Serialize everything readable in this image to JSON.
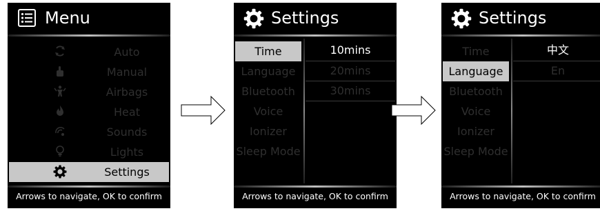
{
  "footer_text": "Arrows to navigate, OK to confirm",
  "screen1": {
    "title": "Menu",
    "items": [
      {
        "label": "Auto",
        "icon": "cycle-icon"
      },
      {
        "label": "Manual",
        "icon": "hand-icon"
      },
      {
        "label": "Airbags",
        "icon": "airbag-person-icon"
      },
      {
        "label": "Heat",
        "icon": "flame-icon"
      },
      {
        "label": "Sounds",
        "icon": "sound-icon"
      },
      {
        "label": "Lights",
        "icon": "lightbulb-icon"
      },
      {
        "label": "Settings",
        "icon": "gear-icon",
        "selected": true
      }
    ]
  },
  "screen2": {
    "title": "Settings",
    "categories": [
      "Time",
      "Language",
      "Bluetooth",
      "Voice",
      "Ionizer",
      "Sleep Mode"
    ],
    "selected_category": "Time",
    "options": [
      "10mins",
      "20mins",
      "30mins"
    ],
    "active_option": "10mins"
  },
  "screen3": {
    "title": "Settings",
    "categories": [
      "Time",
      "Language",
      "Bluetooth",
      "Voice",
      "Ionizer",
      "Sleep Mode"
    ],
    "selected_category": "Language",
    "options": [
      "中文",
      "En"
    ],
    "active_option": "中文"
  },
  "colors": {
    "screen_bg": "#000000",
    "selection_bg": "#c8c8c8",
    "dim_text": "#2f2f2f",
    "text": "#ffffff"
  }
}
